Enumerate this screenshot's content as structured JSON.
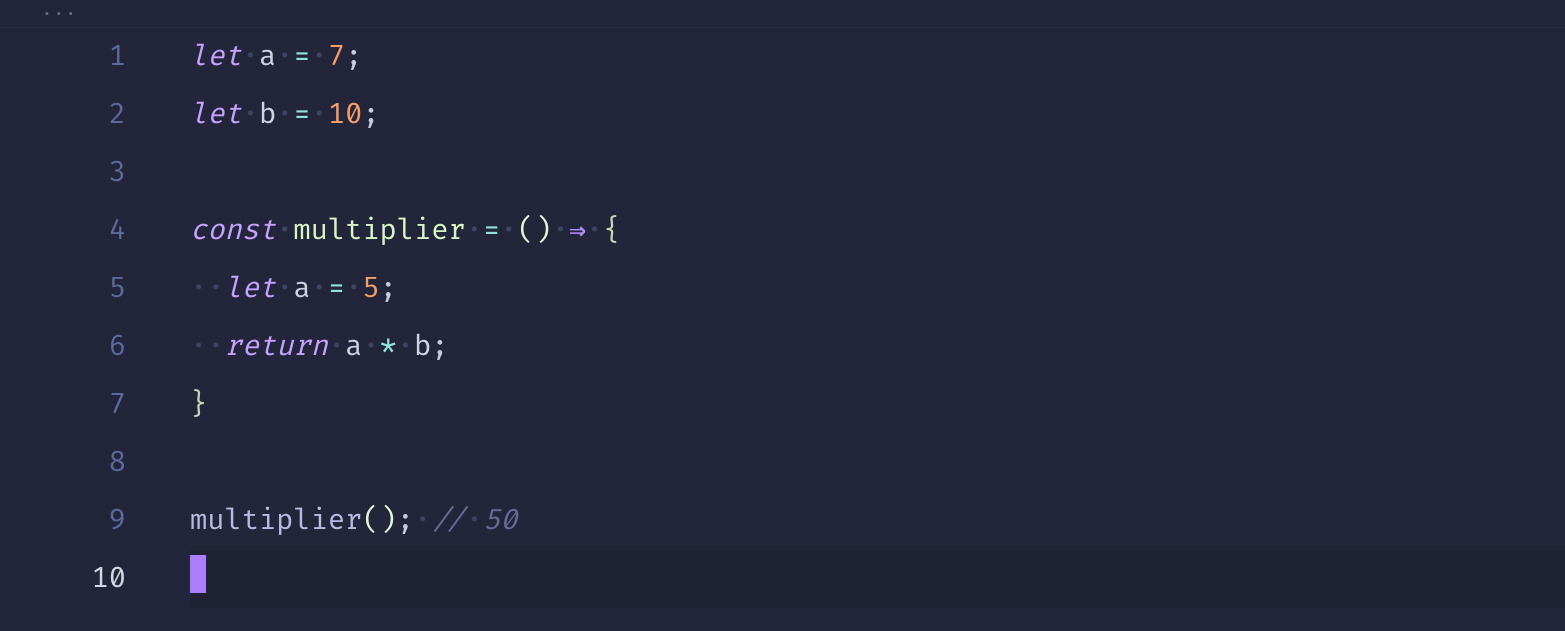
{
  "topbar": {
    "ellipsis": "···"
  },
  "editor": {
    "gutter": {
      "numbers": [
        "1",
        "2",
        "3",
        "4",
        "5",
        "6",
        "7",
        "8",
        "9",
        "10"
      ],
      "activeIndex": 9
    },
    "code": {
      "dot": "·",
      "line1": {
        "kw": "let",
        "v": "a",
        "eq": "=",
        "n": "7",
        "sc": ";"
      },
      "line2": {
        "kw": "let",
        "v": "b",
        "eq": "=",
        "n": "10",
        "sc": ";"
      },
      "line4": {
        "kw": "const",
        "fn": "multiplier",
        "eq": "=",
        "lp": "(",
        "rp": ")",
        "arr": "⇒",
        "lb": "{"
      },
      "line5": {
        "kw": "let",
        "v": "a",
        "eq": "=",
        "n": "5",
        "sc": ";"
      },
      "line6": {
        "kw": "return",
        "a": "a",
        "star": "*",
        "b": "b",
        "sc": ";"
      },
      "line7": {
        "rb": "}"
      },
      "line9": {
        "call": "multiplier",
        "lp": "(",
        "rp": ")",
        "sc": ";",
        "cmt": "//",
        "cn": "50"
      }
    }
  }
}
